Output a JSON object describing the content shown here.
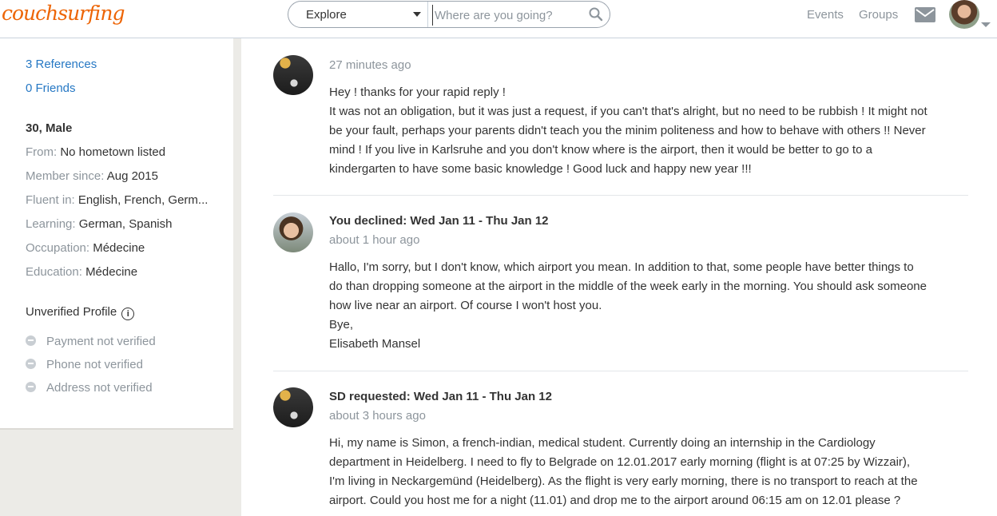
{
  "header": {
    "logo": "couchsurfing",
    "explore_label": "Explore",
    "search_placeholder": "Where are you going?",
    "nav_events": "Events",
    "nav_groups": "Groups"
  },
  "sidebar": {
    "references": "3 References",
    "friends": "0 Friends",
    "age_gender": "30, Male",
    "from_key": "From:",
    "from_val": "No hometown listed",
    "member_key": "Member since:",
    "member_val": "Aug 2015",
    "fluent_key": "Fluent in:",
    "fluent_val": "English, French, Germ...",
    "learning_key": "Learning:",
    "learning_val": "German, Spanish",
    "occupation_key": "Occupation:",
    "occupation_val": "Médecine",
    "education_key": "Education:",
    "education_val": "Médecine",
    "unverified": "Unverified Profile",
    "info_glyph": "i",
    "verify": [
      "Payment not verified",
      "Phone not verified",
      "Address not verified"
    ]
  },
  "messages": [
    {
      "title": "",
      "time": "27 minutes ago",
      "lines": [
        "Hey ! thanks for your rapid reply !",
        "It was not an obligation, but it was just a request, if you can't that's alright, but no need to be rubbish ! It might not",
        "be your fault, perhaps your parents didn't teach you the minim politeness and how to behave with others !! Never",
        "mind ! If you live in Karlsruhe and you don't know where is the airport, then it would be better to go to a",
        "kindergarten to have some basic knowledge ! Good luck and happy new year !!!"
      ]
    },
    {
      "title": "You declined: Wed Jan 11 - Thu Jan 12",
      "time": "about 1 hour ago",
      "lines": [
        "Hallo, I'm sorry, but I don't know, which airport you mean. In addition to that, some people have better things to",
        "do than dropping someone at the airport in the middle of the week early in the morning. You should ask someone",
        "how live near an airport. Of course I won't host you.",
        "Bye,",
        "Elisabeth Mansel"
      ]
    },
    {
      "title": "SD requested: Wed Jan 11 - Thu Jan 12",
      "time": "about 3 hours ago",
      "lines": [
        "Hi, my name is Simon, a french-indian, medical student. Currently doing an internship in the Cardiology",
        "department in Heidelberg. I need to fly to Belgrade on 12.01.2017 early morning (flight is at 07:25 by Wizzair),",
        "I'm living in Neckargemünd (Heidelberg). As the flight is very early morning, there is no transport to reach at the",
        "airport. Could you host me for a night (11.01) and drop me to the airport around 06:15 am on 12.01 please ?"
      ]
    }
  ],
  "icons": [
    "search-icon",
    "mail-icon",
    "info-icon",
    "user-avatar",
    "chevron-down-icon"
  ],
  "colors": {
    "brand": "#ed6506",
    "link": "#2678c4",
    "muted": "#8d959c",
    "text": "#333333"
  }
}
